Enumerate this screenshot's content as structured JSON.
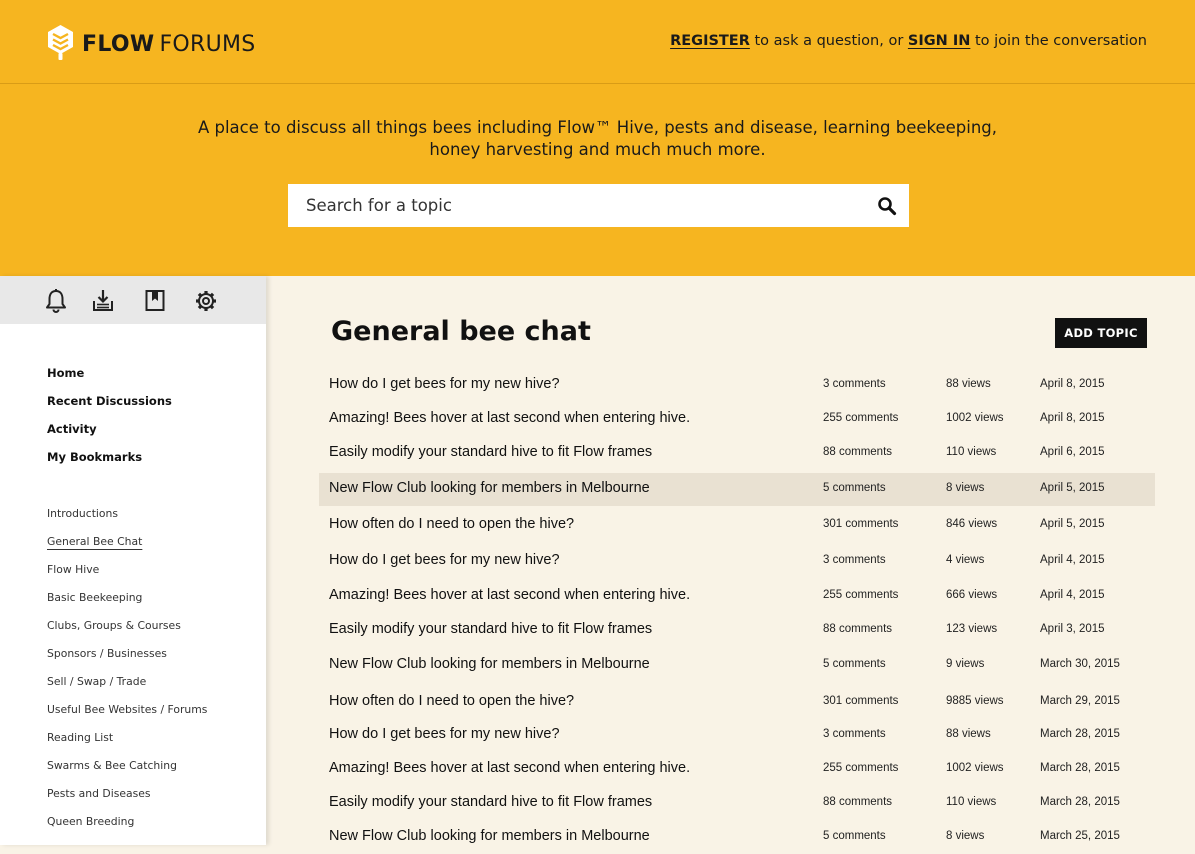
{
  "header": {
    "brand_bold": "FLOW",
    "brand_rest": "FORUMS",
    "register": "REGISTER",
    "register_text": "to ask a question, or",
    "signin": "SIGN IN",
    "signin_text": "to join the conversation"
  },
  "hero": {
    "tagline_line1": "A place to discuss all things bees including Flow™ Hive, pests and disease, learning beekeeping,",
    "tagline_line2": "honey harvesting and much much more.",
    "search_placeholder": "Search for a topic"
  },
  "colors": {
    "brand_yellow": "#f6b520",
    "page_bg": "#f9f3e6",
    "highlight": "#e9e1d2",
    "button": "#111111"
  },
  "icons": [
    "bell-icon",
    "download-icon",
    "bookmark-icon",
    "gear-icon",
    "search-icon",
    "flow-logo-icon"
  ],
  "nav_main": [
    "Home",
    "Recent Discussions",
    "Activity",
    "My Bookmarks"
  ],
  "nav_categories": [
    "Introductions",
    "General Bee Chat",
    "Flow Hive",
    "Basic Beekeeping",
    "Clubs, Groups & Courses",
    "Sponsors / Businesses",
    "Sell / Swap / Trade",
    "Useful Bee Websites / Forums",
    "Reading List",
    "Swarms & Bee Catching",
    "Pests and Diseases",
    "Queen Breeding"
  ],
  "active_category": "General Bee Chat",
  "page": {
    "title": "General bee chat",
    "add_topic": "ADD TOPIC"
  },
  "topics": [
    {
      "title": "How do I get bees for my new hive?",
      "comments": "3 comments",
      "views": "88 views",
      "date": "April 8, 2015"
    },
    {
      "title": "Amazing! Bees hover at last second when entering hive.",
      "comments": "255 comments",
      "views": "1002 views",
      "date": "April 8, 2015"
    },
    {
      "title": "Easily modify your standard hive to fit Flow frames",
      "comments": "88 comments",
      "views": "110 views",
      "date": "April 6, 2015"
    },
    {
      "title": "New Flow Club looking for members in Melbourne",
      "comments": "5 comments",
      "views": "8 views",
      "date": "April 5, 2015",
      "highlighted": true
    },
    {
      "title": "How often do I need to open the hive?",
      "comments": "301 comments",
      "views": "846 views",
      "date": "April 5, 2015"
    },
    {
      "title": "How do I get bees for my new hive?",
      "comments": "3 comments",
      "views": "4 views",
      "date": "April 4, 2015"
    },
    {
      "title": "Amazing! Bees hover at last second when entering hive.",
      "comments": "255 comments",
      "views": "666 views",
      "date": "April 4, 2015"
    },
    {
      "title": "Easily modify your standard hive to fit Flow frames",
      "comments": "88 comments",
      "views": "123 views",
      "date": "April 3, 2015"
    },
    {
      "title": "New Flow Club looking for members in Melbourne",
      "comments": "5 comments",
      "views": "9 views",
      "date": "March 30, 2015"
    },
    {
      "title": "How often do I need to open the hive?",
      "comments": "301 comments",
      "views": "9885 views",
      "date": "March 29, 2015"
    },
    {
      "title": "How do I get bees for my new hive?",
      "comments": "3 comments",
      "views": "88 views",
      "date": "March 28, 2015"
    },
    {
      "title": "Amazing! Bees hover at last second when entering hive.",
      "comments": "255 comments",
      "views": "1002 views",
      "date": "March 28, 2015"
    },
    {
      "title": "Easily modify your standard hive to fit Flow frames",
      "comments": "88 comments",
      "views": "110 views",
      "date": "March 28, 2015"
    },
    {
      "title": "New Flow Club looking for members in Melbourne",
      "comments": "5 comments",
      "views": "8 views",
      "date": "March 25, 2015"
    }
  ]
}
